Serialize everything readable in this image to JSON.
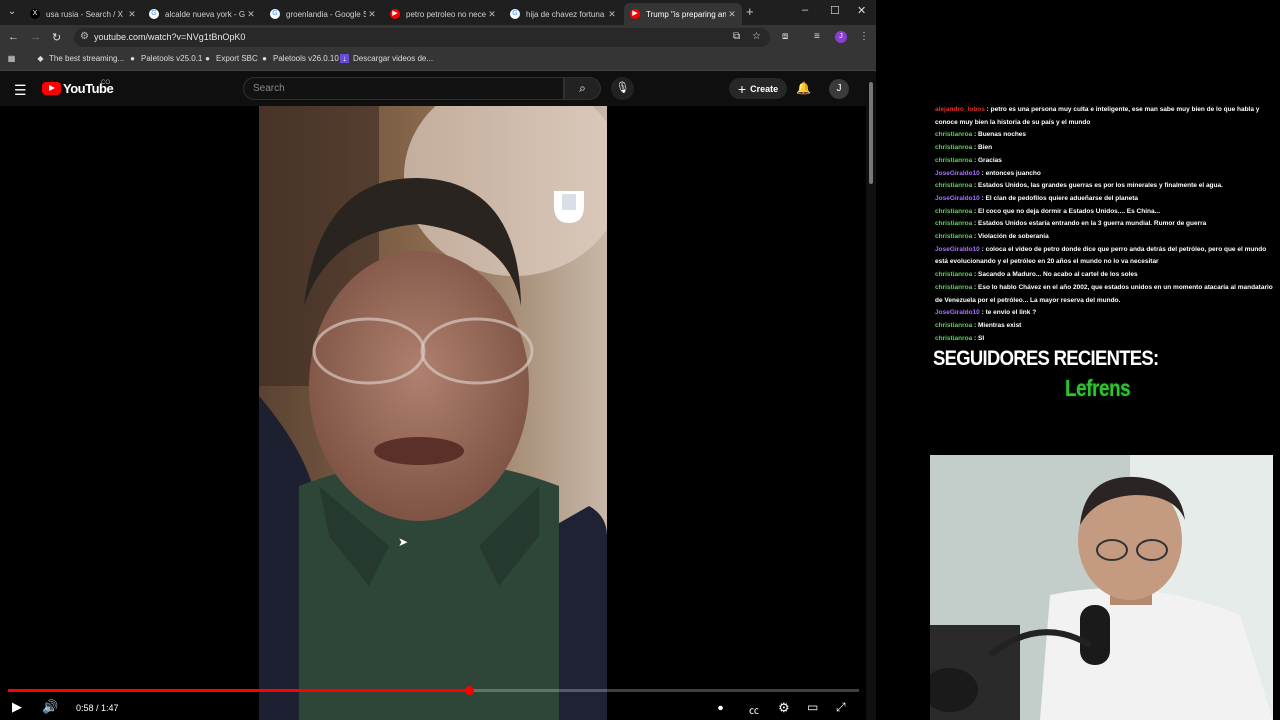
{
  "browser": {
    "tabs": [
      {
        "title": "usa rusia - Search / X",
        "favicon": "x-icon",
        "active": false
      },
      {
        "title": "alcalde nueva york - Go",
        "favicon": "google-icon",
        "active": false
      },
      {
        "title": "groenlandia - Google Se",
        "favicon": "google-icon",
        "active": false
      },
      {
        "title": "petro petroleo no nece",
        "favicon": "youtube-icon",
        "active": false
      },
      {
        "title": "hija de chavez fortuna",
        "favicon": "google-icon",
        "active": false
      },
      {
        "title": "Trump \"is preparing an",
        "favicon": "youtube-icon",
        "active": true
      }
    ],
    "url": "youtube.com/watch?v=NVg1tBnOpK0",
    "bookmarks": [
      {
        "label": "The best streaming..."
      },
      {
        "label": "Paletools v25.0.1"
      },
      {
        "label": "Export SBC"
      },
      {
        "label": "Paletools v26.0.10"
      },
      {
        "label": "Descargar videos de..."
      }
    ]
  },
  "youtube": {
    "logo_text": "YouTube",
    "country_code": "CO",
    "search_placeholder": "Search",
    "create_label": "Create",
    "avatar_letter": "J"
  },
  "player": {
    "time_current": "0:58",
    "time_total": "1:47",
    "progress": 0.542,
    "watermark": "univision-logo"
  },
  "chat": {
    "messages": [
      {
        "user": "alejandro_lobos",
        "text": "petro es una persona muy culta e inteligente, ese man sabe muy bien de lo que habla y conoce muy bien la historia de su país y el mundo",
        "color": "#e03030"
      },
      {
        "user": "christianroa",
        "text": "Buenas noches",
        "color": "#5ad35a"
      },
      {
        "user": "christianroa",
        "text": "Bien",
        "color": "#5ad35a"
      },
      {
        "user": "christianroa",
        "text": "Gracias",
        "color": "#5ad35a"
      },
      {
        "user": "JoseGiraldo10",
        "text": "entonces juancho",
        "color": "#a970ff"
      },
      {
        "user": "christianroa",
        "text": "Estados Unidos, las grandes guerras es por los minerales y finalmente el agua.",
        "color": "#5ad35a"
      },
      {
        "user": "JoseGiraldo10",
        "text": "El clan de pedofilos quiere adueñarse del planeta",
        "color": "#a970ff"
      },
      {
        "user": "christianroa",
        "text": "El coco que no deja dormir a Estados Unidos.... Es China...",
        "color": "#5ad35a"
      },
      {
        "user": "christianroa",
        "text": "Estados Unidos estaría entrando en la 3 guerra mundial. Rumor de guerra",
        "color": "#5ad35a"
      },
      {
        "user": "christianroa",
        "text": "Violación de soberanía",
        "color": "#5ad35a"
      },
      {
        "user": "JoseGiraldo10",
        "text": "coloca el video de petro donde dice que perro anda detrás del petróleo, pero que el mundo está evolucionando y el petróleo en 20 años el mundo no lo va necesitar",
        "color": "#a970ff"
      },
      {
        "user": "christianroa",
        "text": "Sacando a Maduro... No acabo al cartel de los soles",
        "color": "#5ad35a"
      },
      {
        "user": "christianroa",
        "text": "Eso lo hablo Chávez en el año 2002, que estados unidos en un momento atacaría al mandatario de Venezuela por el petróleo... La mayor reserva del mundo.",
        "color": "#5ad35a"
      },
      {
        "user": "JoseGiraldo10",
        "text": "te envio el link ?",
        "color": "#a970ff"
      },
      {
        "user": "christianroa",
        "text": "Mientras exist",
        "color": "#5ad35a"
      },
      {
        "user": "christianroa",
        "text": "SI",
        "color": "#5ad35a"
      }
    ]
  },
  "overlay": {
    "followers_title": "SEGUIDORES RECIENTES:",
    "follower_name": "Lefrens"
  }
}
